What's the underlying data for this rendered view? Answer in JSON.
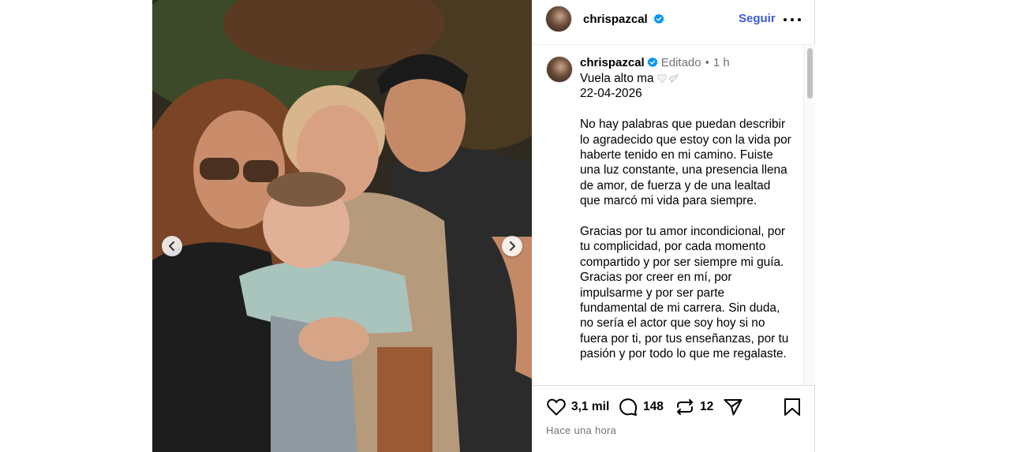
{
  "post": {
    "username": "chrispazcal",
    "verified": true,
    "follow_label": "Seguir",
    "caption": {
      "username": "chrispazcal",
      "edited_label": "Editado",
      "separator": "•",
      "time_ago": "1 h",
      "line1": "Vuela alto ma",
      "line2": "22-04-2026",
      "paragraph1": "No hay palabras que puedan describir lo agradecido que estoy con la vida por haberte tenido en mi camino. Fuiste una luz constante, una presencia llena de amor, de fuerza y de una lealtad que marcó mi vida para siempre.",
      "paragraph2": "Gracias por tu amor incondicional, por tu complicidad, por cada momento compartido y por ser siempre mi guía. Gracias por creer en mí, por impulsarme y por ser parte fundamental de mi carrera. Sin duda, no sería el actor que soy hoy si no fuera por ti, por tus enseñanzas, por tu pasión y por todo lo que me regalaste."
    },
    "stats": {
      "likes": "3,1 mil",
      "comments": "148",
      "reposts": "12"
    },
    "posted_label": "Hace una hora"
  },
  "icons": {
    "verified": "verified-badge-icon",
    "more": "more-options-icon",
    "like": "heart-icon",
    "comment": "comment-bubble-icon",
    "repost": "repost-icon",
    "share": "share-icon",
    "save": "bookmark-icon",
    "prev": "chevron-left-icon",
    "next": "chevron-right-icon"
  },
  "colors": {
    "accent": "#0095f6",
    "follow": "#3b5bdb",
    "muted": "#737373",
    "border": "#dbdbdb"
  }
}
